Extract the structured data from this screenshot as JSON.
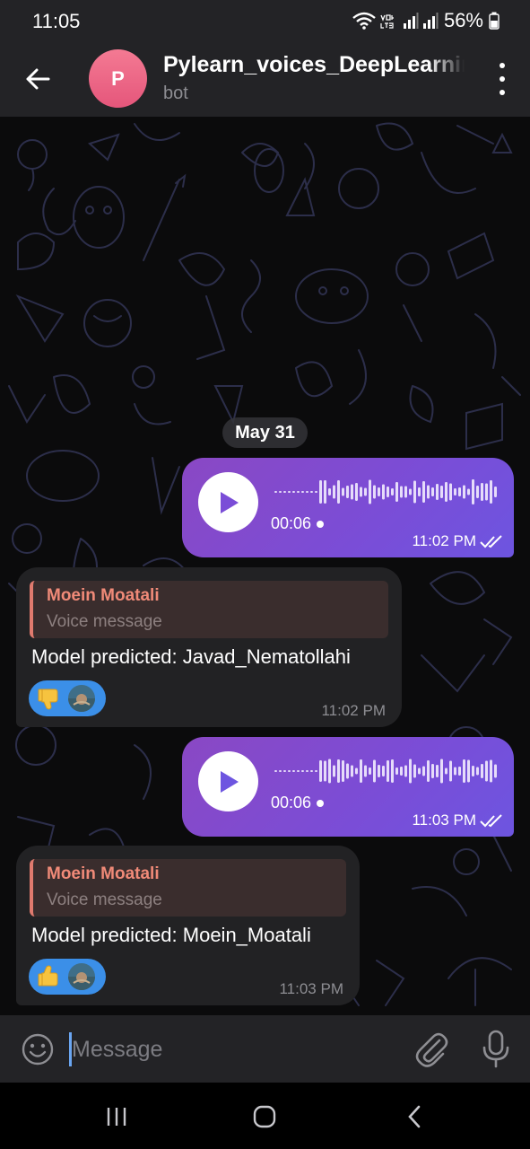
{
  "status_bar": {
    "time": "11:05",
    "battery": "56%"
  },
  "header": {
    "avatar_letter": "P",
    "title": "Pylearn_voices_DeepLearning",
    "subtitle": "bot",
    "accent": "#e5567b"
  },
  "chat": {
    "date_chip": "May 31",
    "messages": [
      {
        "type": "voice",
        "direction": "outgoing",
        "duration": "00:06",
        "time": "11:02 PM",
        "status": "read"
      },
      {
        "type": "text",
        "direction": "incoming",
        "reply_name": "Moein Moatali",
        "reply_text": "Voice message",
        "text": "Model predicted: Javad_Nematollahi",
        "reaction": "thumbs-down",
        "time": "11:02 PM"
      },
      {
        "type": "voice",
        "direction": "outgoing",
        "duration": "00:06",
        "time": "11:03 PM",
        "status": "read"
      },
      {
        "type": "text",
        "direction": "incoming",
        "reply_name": "Moein Moatali",
        "reply_text": "Voice message",
        "text": "Model predicted: Moein_Moatali",
        "reaction": "thumbs-up",
        "time": "11:03 PM"
      }
    ]
  },
  "input": {
    "placeholder": "Message",
    "value": ""
  },
  "colors": {
    "outgoing_bubble": "#7a4dd7",
    "incoming_bubble": "#222224",
    "reply_accent": "#e07a6e",
    "reaction_bg": "#3b8fe8"
  }
}
